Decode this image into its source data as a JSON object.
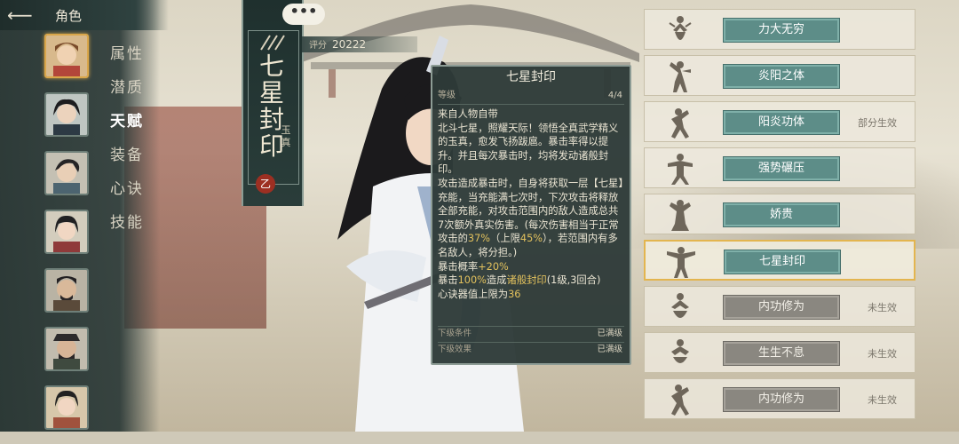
{
  "header": {
    "back_icon": "back-arrow-icon",
    "title": "角色"
  },
  "portraits": [
    {
      "name": "character-1",
      "selected": true
    },
    {
      "name": "character-2",
      "selected": false
    },
    {
      "name": "character-3",
      "selected": false
    },
    {
      "name": "character-4",
      "selected": false
    },
    {
      "name": "character-5",
      "selected": false
    },
    {
      "name": "character-6",
      "selected": false
    },
    {
      "name": "character-7",
      "selected": false
    }
  ],
  "menu": [
    {
      "label": "属性",
      "active": false
    },
    {
      "label": "潜质",
      "active": false
    },
    {
      "label": "天赋",
      "active": true
    },
    {
      "label": "装备",
      "active": false
    },
    {
      "label": "心诀",
      "active": false
    },
    {
      "label": "技能",
      "active": false
    }
  ],
  "banner": {
    "name": "七星封印",
    "sub": "玉真",
    "seal": "乙",
    "chat_label": "•••"
  },
  "score": {
    "label": "评分",
    "value": "20222"
  },
  "tooltip": {
    "title": "七星封印",
    "level_label": "等级",
    "level_value": "4/4",
    "p1": "来自人物自带",
    "p2": "北斗七星，照耀天际！领悟全真武学精义的玉真，愈发飞扬跋扈。暴击率得以提升。并且每次暴击时，均将发动诸般封印。",
    "p3a": "攻击造成暴击时，自身将获取一层【七星】充能，当充能满七次时，下次攻击将释放全部充能，对攻击范围内的敌人造成总共7次额外真实伤害。(每次伤害相当于正常攻击的",
    "p3_pct": "37%",
    "p3b": "（上限",
    "p3_cap": "45%",
    "p3c": "），若范围内有多名敌人，将分担。)",
    "p4a": "暴击概率",
    "p4_val": "+20%",
    "p5a": "暴击",
    "p5_val": "100%",
    "p5b": "造成",
    "p5_link": "诸般封印",
    "p5c": "(1级,3回合)",
    "p6a": "心诀器值上限为",
    "p6_val": "36",
    "foot1_label": "下级条件",
    "foot1_value": "已满级",
    "foot2_label": "下级效果",
    "foot2_value": "已满级"
  },
  "talents": [
    {
      "icon": "figure-pose-icon",
      "label": "力大无穷",
      "status": "",
      "state": "active"
    },
    {
      "icon": "figure-pose-icon",
      "label": "炎阳之体",
      "status": "",
      "state": "active"
    },
    {
      "icon": "figure-pose-icon",
      "label": "阳炎功体",
      "status": "部分生效",
      "state": "active"
    },
    {
      "icon": "figure-pose-icon",
      "label": "强势碾压",
      "status": "",
      "state": "active"
    },
    {
      "icon": "figure-pose-icon",
      "label": "娇贵",
      "status": "",
      "state": "active"
    },
    {
      "icon": "figure-pose-icon",
      "label": "七星封印",
      "status": "",
      "state": "selected"
    },
    {
      "icon": "figure-pose-icon",
      "label": "内功修为",
      "status": "未生效",
      "state": "inactive"
    },
    {
      "icon": "figure-pose-icon",
      "label": "生生不息",
      "status": "未生效",
      "state": "inactive"
    },
    {
      "icon": "figure-pose-icon",
      "label": "内功修为",
      "status": "未生效",
      "state": "inactive"
    }
  ],
  "colors": {
    "accent_teal": "#5d8d88",
    "highlight_gold": "#e2c15d",
    "selection_border": "#e3b54f"
  }
}
